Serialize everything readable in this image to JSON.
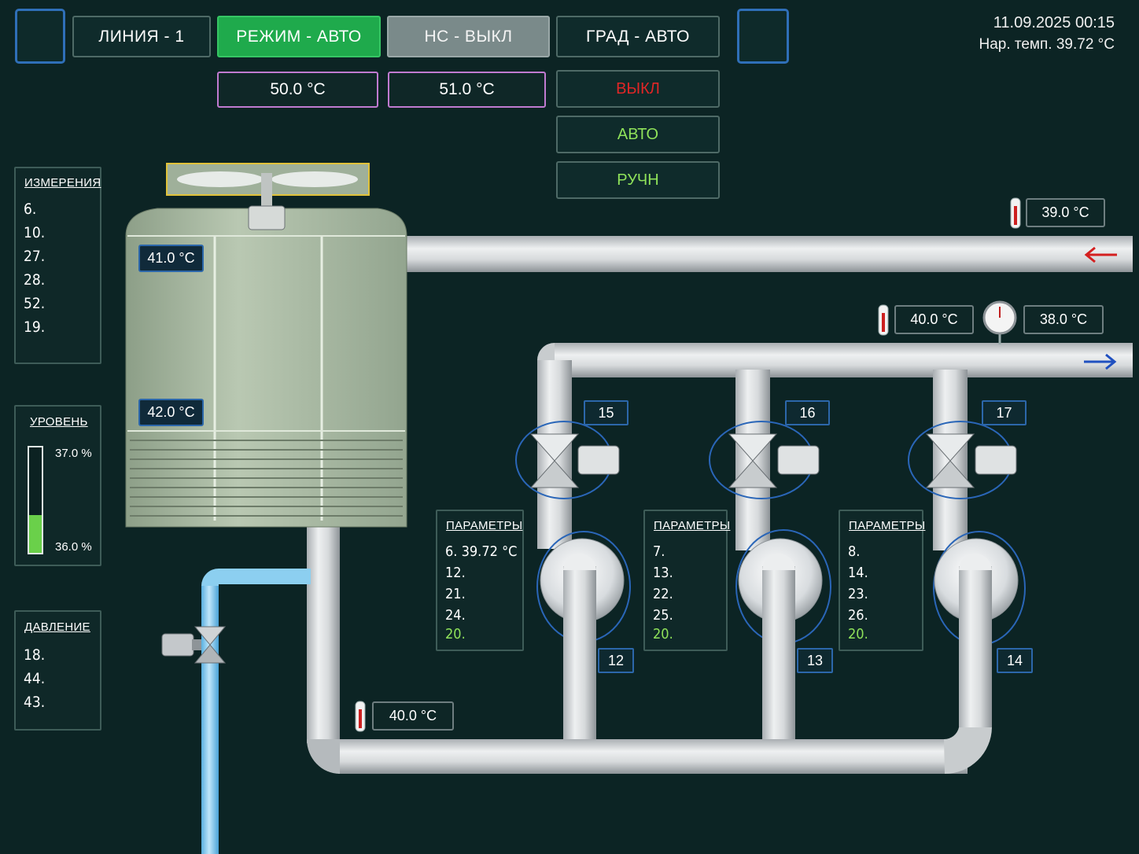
{
  "header": {
    "line_label": "ЛИНИЯ - 1",
    "mode_label": "РЕЖИМ - АВТО",
    "ns_label": "НС - ВЫКЛ",
    "grad_label": "ГРАД - АВТО",
    "datetime": "11.09.2025 00:15",
    "outdoor_temp": "Нар. темп.  39.72 °C"
  },
  "setpoints": {
    "sp1": "50.0 °C",
    "sp2": "51.0 °C"
  },
  "modes": {
    "off": "ВЫКЛ",
    "auto": "АВТО",
    "manual": "РУЧН"
  },
  "measurements": {
    "title": "ИЗМЕРЕНИЯ",
    "items": [
      "6.",
      "10.",
      "27.",
      "28.",
      "52.",
      "19."
    ]
  },
  "level": {
    "title": "УРОВЕНЬ",
    "top_value": "37.0 %",
    "bottom_value": "36.0 %",
    "fill_fraction": 0.36
  },
  "pressure": {
    "title": "ДАВЛЕНИЕ",
    "items": [
      "18.",
      "44.",
      "43."
    ]
  },
  "tower": {
    "temp_top": "41.0 °C",
    "temp_bottom": "42.0 °C"
  },
  "pipes": {
    "return_temp": "39.0 °C",
    "supply_temp": "40.0 °C",
    "supply_gauge": "38.0 °C",
    "bottom_temp": "40.0 °C"
  },
  "units": [
    {
      "valve_id": "15",
      "pump_id": "12",
      "params_title": "ПАРАМЕТРЫ",
      "params": [
        "6.  39.72 °C",
        "12.",
        "21.",
        "24."
      ],
      "status": "20."
    },
    {
      "valve_id": "16",
      "pump_id": "13",
      "params_title": "ПАРАМЕТРЫ",
      "params": [
        "7.",
        "13.",
        "22.",
        "25."
      ],
      "status": "20."
    },
    {
      "valve_id": "17",
      "pump_id": "14",
      "params_title": "ПАРАМЕТРЫ",
      "params": [
        "8.",
        "14.",
        "23.",
        "26."
      ],
      "status": "20."
    }
  ],
  "colors": {
    "background": "#0c2424",
    "active_green": "#1faa4c",
    "off_red": "#e02626",
    "on_green": "#8fe25a",
    "return_arrow": "#d42020",
    "supply_arrow": "#2050c0",
    "water": "#8ccff0"
  }
}
